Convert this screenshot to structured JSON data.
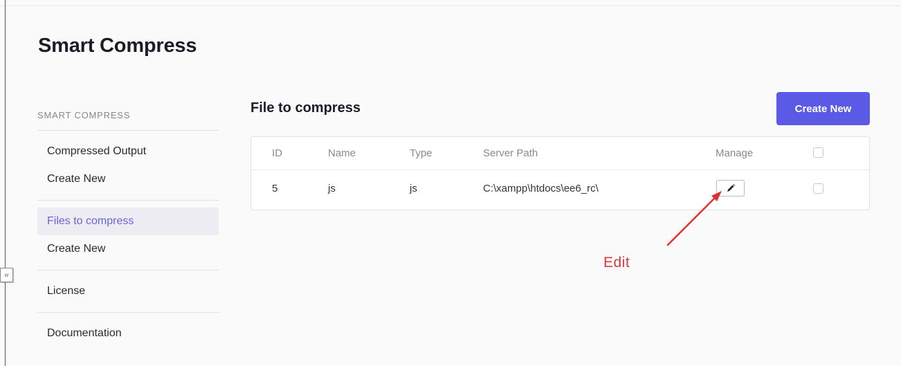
{
  "app": {
    "title": "Smart Compress"
  },
  "sidebar": {
    "heading": "SMART COMPRESS",
    "groups": [
      {
        "items": [
          {
            "label": "Compressed Output"
          },
          {
            "label": "Create New"
          }
        ]
      },
      {
        "items": [
          {
            "label": "Files to compress",
            "active": true
          },
          {
            "label": "Create New"
          }
        ]
      },
      {
        "items": [
          {
            "label": "License"
          }
        ]
      },
      {
        "items": [
          {
            "label": "Documentation"
          }
        ]
      }
    ]
  },
  "main": {
    "title": "File to compress",
    "create_button": "Create New",
    "table": {
      "columns": [
        "ID",
        "Name",
        "Type",
        "Server Path",
        "Manage"
      ],
      "rows": [
        {
          "id": "5",
          "name": "js",
          "type": "js",
          "server_path": "C:\\xampp\\htdocs\\ee6_rc\\"
        }
      ]
    }
  },
  "annotation": {
    "label": "Edit",
    "color": "#d63a3a"
  },
  "edge_tab": {
    "text": "w"
  },
  "colors": {
    "accent": "#5a5ae6",
    "active_text": "#6a64d8",
    "active_bg": "#ececf2"
  },
  "icons": {
    "edit": "pencil-icon"
  }
}
